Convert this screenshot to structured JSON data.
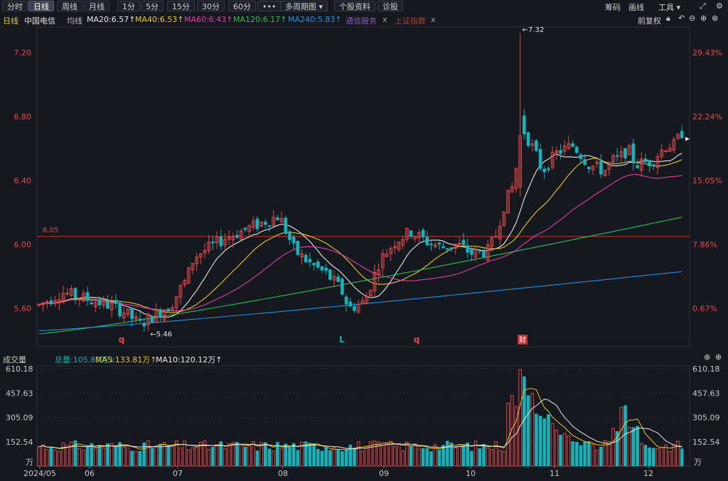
{
  "toolbar": {
    "tabs": [
      {
        "label": "分时",
        "active": false
      },
      {
        "label": "日线",
        "active": true
      },
      {
        "label": "周线",
        "active": false
      },
      {
        "label": "月线",
        "active": false
      },
      {
        "label": "1分",
        "active": false
      },
      {
        "label": "5分",
        "active": false
      },
      {
        "label": "15分",
        "active": false
      },
      {
        "label": "30分",
        "active": false
      },
      {
        "label": "60分",
        "active": false
      },
      {
        "label": "•••",
        "active": false
      },
      {
        "label": "多周期图 ▾",
        "active": false
      },
      {
        "label": "个股资料",
        "active": false
      },
      {
        "label": "诊股",
        "active": false
      }
    ],
    "right": {
      "chips": "筹码",
      "draw": "画线",
      "tools": "工具 ▾"
    }
  },
  "info": {
    "period": "日线",
    "stock": "中国电信",
    "ma_label": "均线",
    "ma20": "MA20:6.57↑",
    "ma40": "MA40:6.53↑",
    "ma60": "MA60:6.43↑",
    "ma120": "MA120:6.17↑",
    "ma240": "MA240:5.83↑",
    "compare1": "通信服务",
    "compare2": "上证指数",
    "close_x": "x",
    "adjust": "前复权"
  },
  "volume_info": {
    "title": "成交量",
    "total": "总量:105.80万↓",
    "ma5": "MA5:133.81万↑",
    "ma10": "MA10:120.12万↑"
  },
  "colors": {
    "up": "#e04a4a",
    "down": "#1ab0b8",
    "ma20": "#e8e8e8",
    "ma40": "#e8c832",
    "ma60": "#e040a8",
    "ma120": "#30c050",
    "ma240": "#2890e8",
    "ref": "#c83232",
    "accent_text": "#e6e6e6"
  },
  "chart_data": {
    "type": "candlestick",
    "price_axis": {
      "ticks": [
        7.2,
        6.8,
        6.4,
        6.0,
        5.6
      ],
      "tick_labels": [
        "7.20",
        "6.80",
        "6.40",
        "6.00",
        "5.60"
      ],
      "ylim": [
        5.36,
        7.36
      ]
    },
    "pct_axis": {
      "ticks": [
        "29.43%",
        "22.24%",
        "15.05%",
        "7.86%",
        "0.67%"
      ]
    },
    "ref_line": {
      "value": 6.05,
      "label": "6.05"
    },
    "annotations": [
      {
        "text": "←7.32",
        "value": 7.32,
        "kind": "high"
      },
      {
        "text": "←5.46",
        "value": 5.46,
        "kind": "low"
      }
    ],
    "markers": [
      "q",
      "L",
      "q",
      "财"
    ],
    "x_labels": [
      "2024/05",
      "06",
      "07",
      "08",
      "09",
      "10",
      "11",
      "12"
    ],
    "ma_end_values": {
      "ma20": 6.57,
      "ma40": 6.53,
      "ma60": 6.43,
      "ma120": 6.17,
      "ma240": 5.83
    },
    "volume": {
      "unit": "万",
      "ticks": [
        "610.18",
        "457.63",
        "305.09",
        "152.54"
      ],
      "ylim": [
        0,
        610.18
      ]
    }
  }
}
